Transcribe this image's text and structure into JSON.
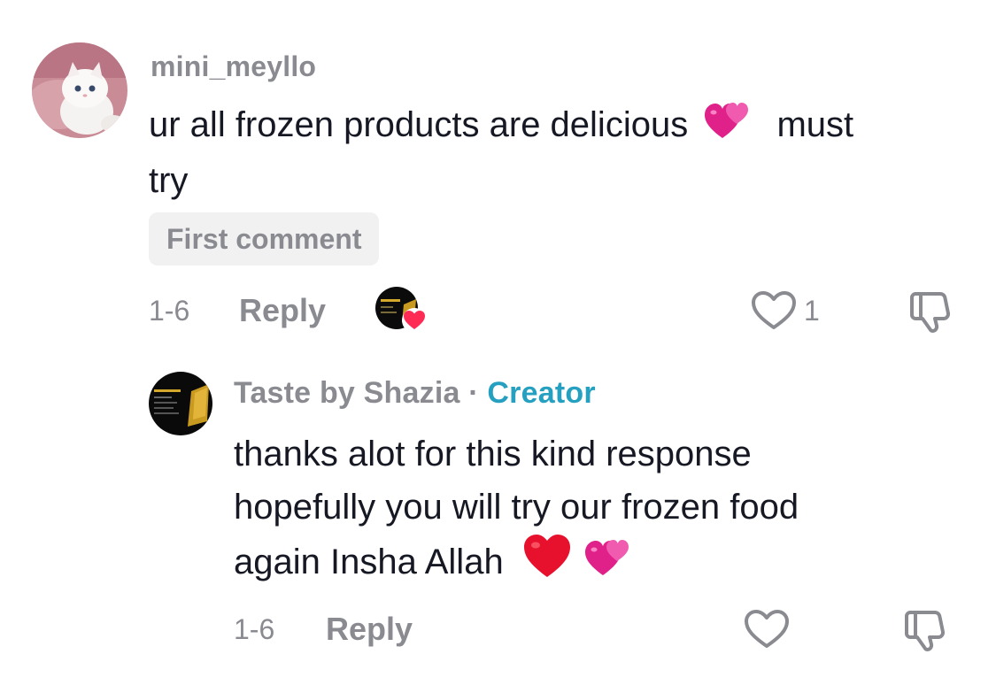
{
  "comment": {
    "username": "mini_meyllo",
    "text_part1": "ur all frozen products are delicious",
    "text_part2": "must",
    "text_part3": "try",
    "emoji_1": "heart-hearts-icon",
    "badge": "First comment",
    "date": "1-6",
    "reply_label": "Reply",
    "like_count": "1"
  },
  "reply": {
    "username": "Taste by Shazia",
    "separator": "·",
    "creator_label": "Creator",
    "line1": "thanks alot for this kind response",
    "line2": "hopefully you will try our frozen food",
    "line3": "again Insha Allah",
    "emoji_1": "red-heart-icon",
    "emoji_2": "two-hearts-icon",
    "date": "1-6",
    "reply_label": "Reply"
  },
  "colors": {
    "muted": "#8a8b91",
    "creator": "#25a0c0",
    "text": "#161823",
    "badge_bg": "#f1f1f2",
    "heart_pink": "#fe2c55"
  }
}
